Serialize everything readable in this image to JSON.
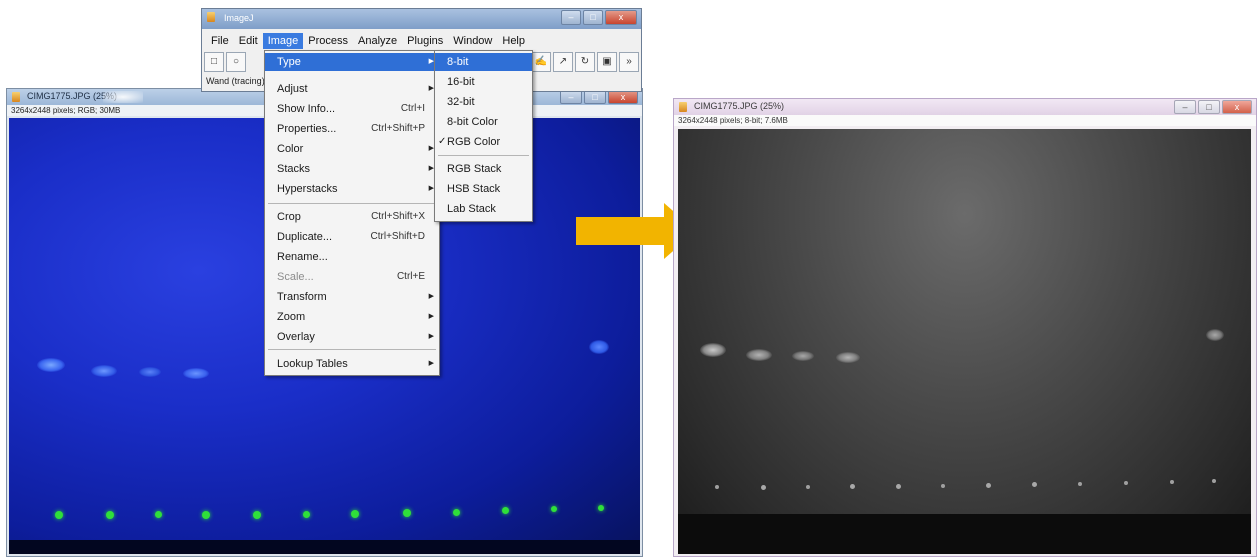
{
  "imagej": {
    "title": "ImageJ",
    "menus": [
      "File",
      "Edit",
      "Image",
      "Process",
      "Analyze",
      "Plugins",
      "Window",
      "Help"
    ],
    "active_menu": "Image",
    "status": "Wand (tracing)"
  },
  "image_menu": {
    "items": [
      {
        "label": "Type"
      },
      {
        "label": "Adjust"
      },
      {
        "label": "Show Info...",
        "shortcut": "Ctrl+I"
      },
      {
        "label": "Properties...",
        "shortcut": "Ctrl+Shift+P"
      },
      {
        "label": "Color"
      },
      {
        "label": "Stacks"
      },
      {
        "label": "Hyperstacks"
      },
      {
        "label": "Crop",
        "shortcut": "Ctrl+Shift+X"
      },
      {
        "label": "Duplicate...",
        "shortcut": "Ctrl+Shift+D"
      },
      {
        "label": "Rename..."
      },
      {
        "label": "Scale...",
        "shortcut": "Ctrl+E"
      },
      {
        "label": "Transform"
      },
      {
        "label": "Zoom"
      },
      {
        "label": "Overlay"
      },
      {
        "label": "Lookup Tables"
      }
    ]
  },
  "type_menu": {
    "items": [
      {
        "label": "8-bit"
      },
      {
        "label": "16-bit"
      },
      {
        "label": "32-bit"
      },
      {
        "label": "8-bit Color"
      },
      {
        "label": "RGB Color",
        "checked": "✓"
      },
      {
        "label": "RGB Stack"
      },
      {
        "label": "HSB Stack"
      },
      {
        "label": "Lab Stack"
      }
    ]
  },
  "left_window": {
    "title": "CIMG1775.JPG (25%)",
    "info": "3264x2448 pixels; RGB; 30MB",
    "color": "#1a2ec8"
  },
  "right_window": {
    "title": "CIMG1775.JPG (25%)",
    "info": "3264x2448 pixels; 8-bit; 7.6MB",
    "color": "#4a4a4a"
  },
  "arrow": {
    "color": "#f2b400",
    "icon": "right-arrow-icon"
  }
}
